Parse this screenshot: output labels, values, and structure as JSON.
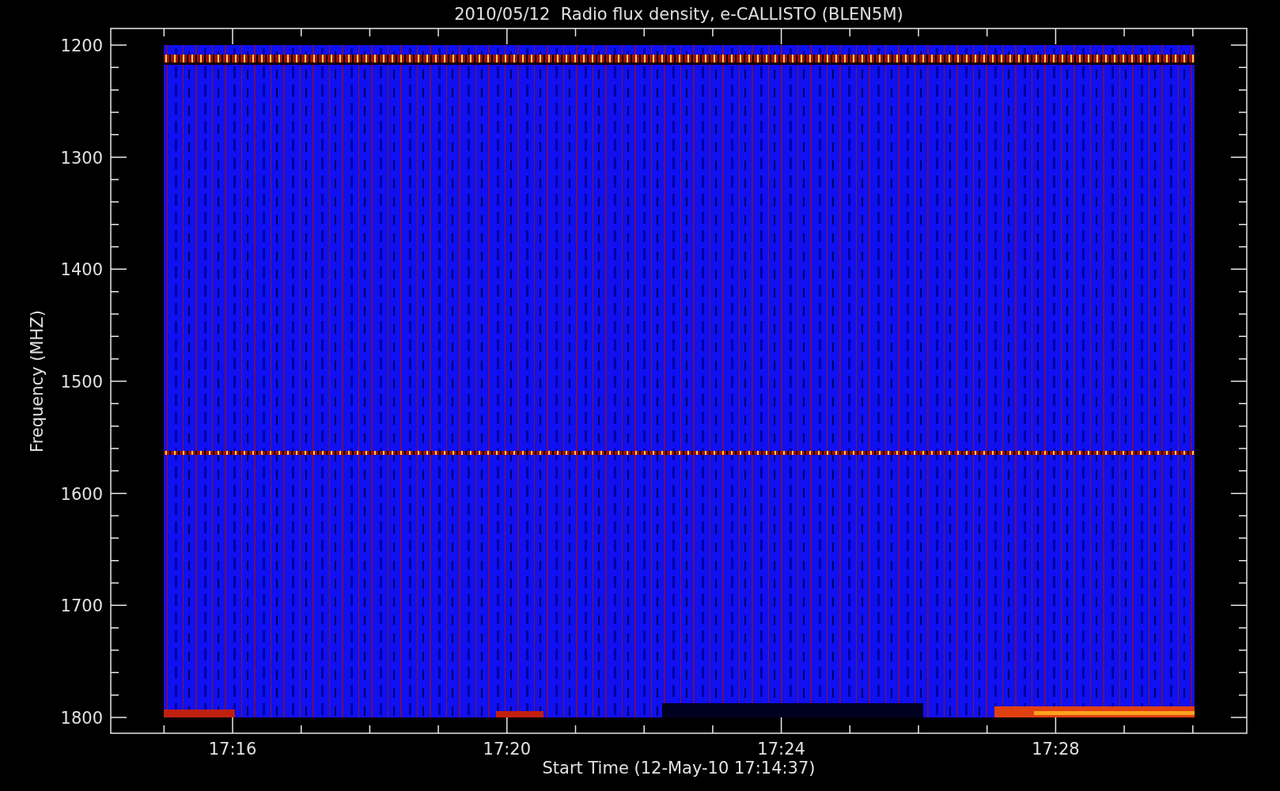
{
  "title": "2010/05/12  Radio flux density, e-CALLISTO (BLEN5M)",
  "y_axis": {
    "label": "Frequency (MHZ)",
    "ticks": [
      "1200",
      "1300",
      "1400",
      "1500",
      "1600",
      "1700",
      "1800"
    ]
  },
  "x_axis": {
    "label": "Start Time (12-May-10 17:14:37)",
    "ticks": [
      "17:16",
      "17:20",
      "17:24",
      "17:28"
    ]
  }
}
